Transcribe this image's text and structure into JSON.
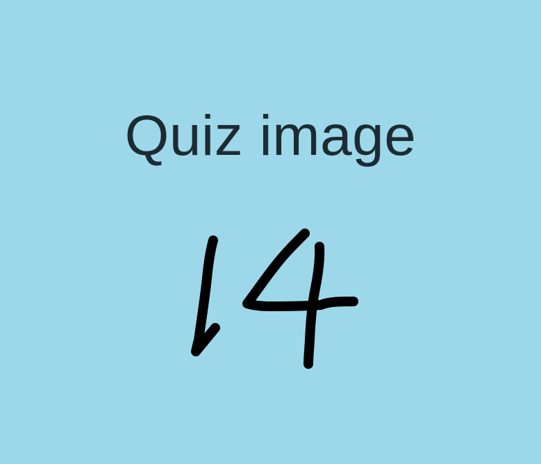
{
  "slide": {
    "background_color": "#9DD8EA",
    "title": "Quiz image",
    "number": "14",
    "number_color": "#000000"
  }
}
